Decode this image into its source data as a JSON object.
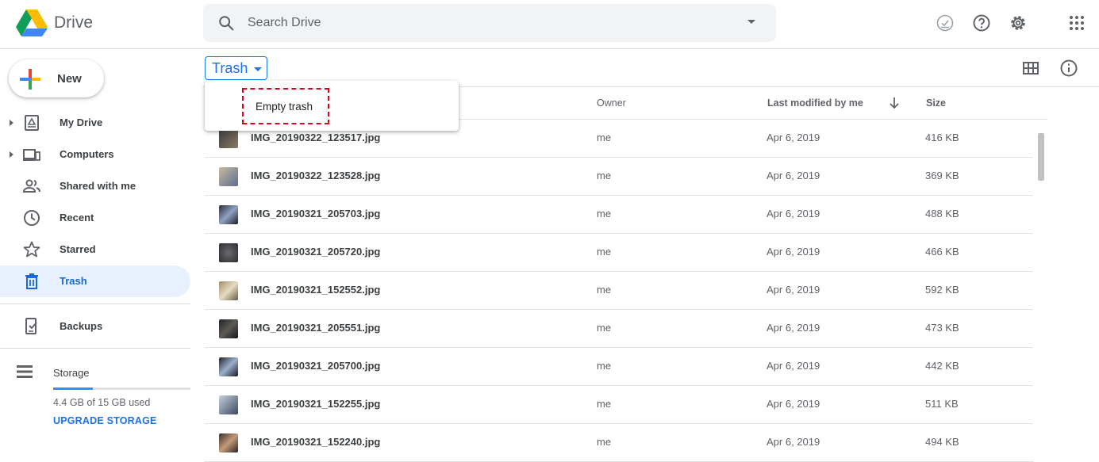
{
  "app": {
    "name": "Drive"
  },
  "search": {
    "placeholder": "Search Drive"
  },
  "sidebar": {
    "new_label": "New",
    "items": [
      {
        "label": "My Drive",
        "icon": "my-drive-icon"
      },
      {
        "label": "Computers",
        "icon": "computers-icon"
      },
      {
        "label": "Shared with me",
        "icon": "shared-icon"
      },
      {
        "label": "Recent",
        "icon": "clock-icon"
      },
      {
        "label": "Starred",
        "icon": "star-icon"
      },
      {
        "label": "Trash",
        "icon": "trash-icon",
        "active": true
      },
      {
        "label": "Backups",
        "icon": "backups-icon"
      }
    ],
    "storage": {
      "title": "Storage",
      "used_text": "4.4 GB of 15 GB used",
      "used_fraction": 0.29,
      "upgrade_label": "UPGRADE STORAGE"
    }
  },
  "breadcrumb": {
    "label": "Trash"
  },
  "menu": {
    "item": "Empty trash"
  },
  "table": {
    "columns": {
      "owner": "Owner",
      "modified": "Last modified by me",
      "size": "Size"
    },
    "rows": [
      {
        "name": "IMG_20190322_123517.jpg",
        "owner": "me",
        "modified": "Apr 6, 2019",
        "size": "416 KB"
      },
      {
        "name": "IMG_20190322_123528.jpg",
        "owner": "me",
        "modified": "Apr 6, 2019",
        "size": "369 KB"
      },
      {
        "name": "IMG_20190321_205703.jpg",
        "owner": "me",
        "modified": "Apr 6, 2019",
        "size": "488 KB"
      },
      {
        "name": "IMG_20190321_205720.jpg",
        "owner": "me",
        "modified": "Apr 6, 2019",
        "size": "466 KB"
      },
      {
        "name": "IMG_20190321_152552.jpg",
        "owner": "me",
        "modified": "Apr 6, 2019",
        "size": "592 KB"
      },
      {
        "name": "IMG_20190321_205551.jpg",
        "owner": "me",
        "modified": "Apr 6, 2019",
        "size": "473 KB"
      },
      {
        "name": "IMG_20190321_205700.jpg",
        "owner": "me",
        "modified": "Apr 6, 2019",
        "size": "442 KB"
      },
      {
        "name": "IMG_20190321_152255.jpg",
        "owner": "me",
        "modified": "Apr 6, 2019",
        "size": "511 KB"
      },
      {
        "name": "IMG_20190321_152240.jpg",
        "owner": "me",
        "modified": "Apr 6, 2019",
        "size": "494 KB"
      }
    ]
  },
  "colors": {
    "accent": "#1a73e8",
    "active_bg": "#e8f0fe",
    "highlight": "#e0001b"
  }
}
